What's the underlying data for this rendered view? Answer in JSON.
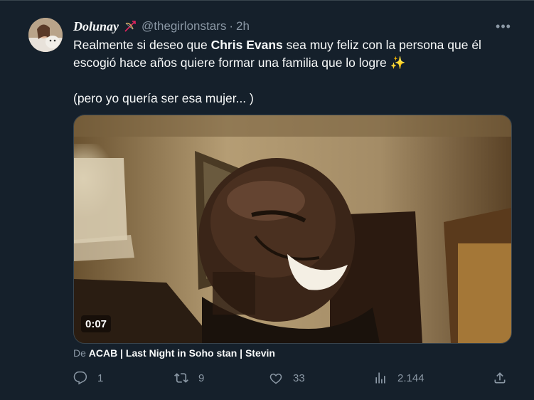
{
  "tweet": {
    "author_name": "Dolunay",
    "handle": "@thegirlonstars",
    "separator": "·",
    "time": "2h",
    "text_before": "Realmente si deseo que ",
    "text_bold": "Chris Evans",
    "text_after": " sea muy feliz con la persona que él escogió hace años quiere formar una familia que lo logre ",
    "sparkle": "✨",
    "text_second": "(pero yo quería ser esa mujer... )"
  },
  "media": {
    "duration": "0:07"
  },
  "source": {
    "prefix": "De ",
    "name": "ACAB | Last Night in Soho stan | Stevin"
  },
  "actions": {
    "reply_count": "1",
    "retweet_count": "9",
    "like_count": "33",
    "views_count": "2.144"
  },
  "icons": {
    "author_badge": "bow-and-arrow-icon",
    "more": "more-options-icon",
    "reply": "reply-icon",
    "retweet": "retweet-icon",
    "like": "heart-icon",
    "views": "analytics-icon",
    "share": "share-icon"
  },
  "colors": {
    "background": "#15202b",
    "secondary_text": "#8b98a5",
    "border": "#38444d"
  }
}
